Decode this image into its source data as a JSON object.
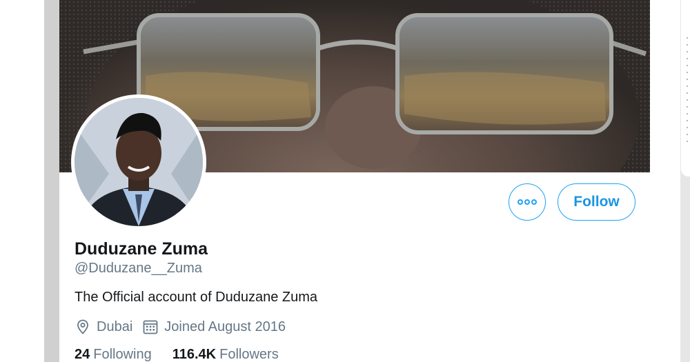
{
  "profile": {
    "display_name": "Duduzane Zuma",
    "handle": "@Duduzane__Zuma",
    "bio": "The Official account of Duduzane Zuma",
    "location": "Dubai",
    "joined": "Joined August 2016",
    "following_count": "24",
    "following_label": "Following",
    "followers_count": "116.4K",
    "followers_label": "Followers"
  },
  "actions": {
    "follow_label": "Follow",
    "more_icon": "more-horizontal-icon"
  },
  "icons": {
    "location": "location-pin-icon",
    "calendar": "calendar-icon"
  },
  "colors": {
    "accent": "#1da1f2",
    "follow_text": "#1b95e0",
    "primary_text": "#14171a",
    "secondary_text": "#657786"
  }
}
